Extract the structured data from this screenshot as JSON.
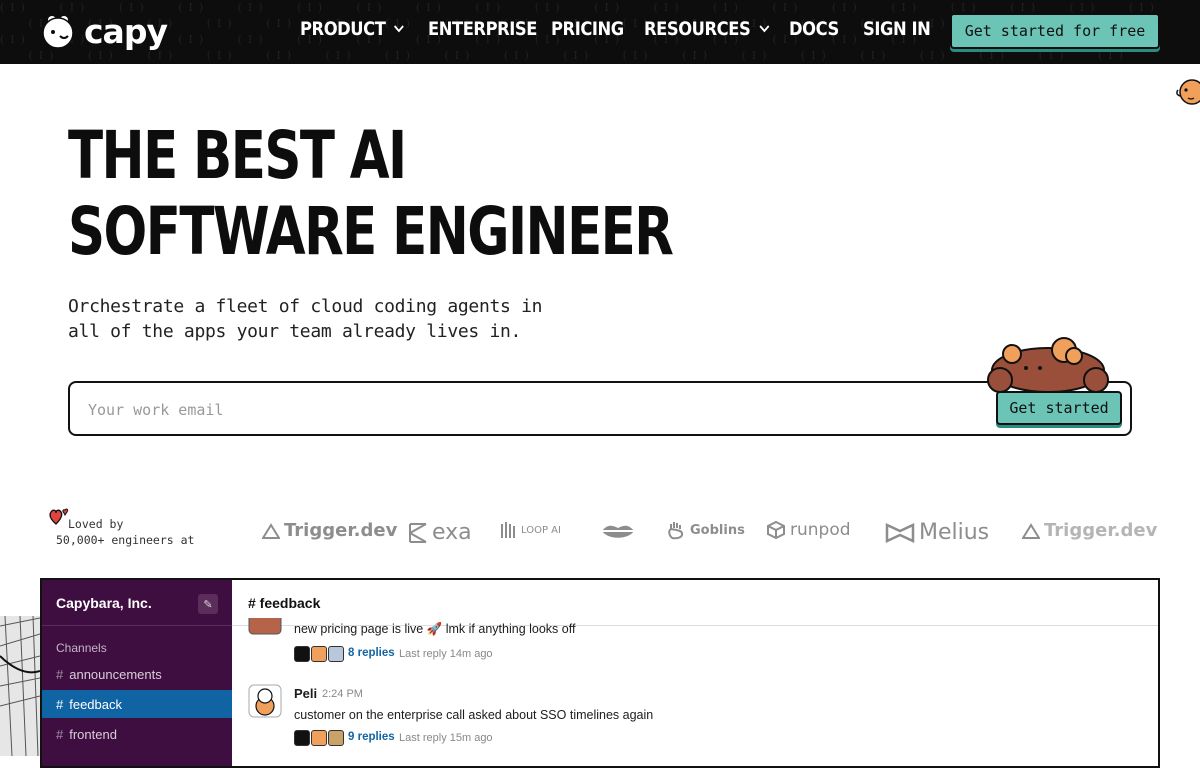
{
  "nav": {
    "logo_text": "capy",
    "links": [
      {
        "label": "PRODUCT",
        "dropdown": true
      },
      {
        "label": "ENTERPRISE",
        "dropdown": false
      },
      {
        "label": "PRICING",
        "dropdown": false
      },
      {
        "label": "RESOURCES",
        "dropdown": true
      },
      {
        "label": "DOCS",
        "dropdown": false
      },
      {
        "label": "SIGN IN",
        "dropdown": false
      }
    ],
    "cta_label": "Get started for free"
  },
  "hero": {
    "title_line1": "THE BEST AI",
    "title_line2": "SOFTWARE ENGINEER",
    "subtitle_line1": "Orchestrate a fleet of cloud coding agents in",
    "subtitle_line2": "all of the apps your team already lives in.",
    "email_placeholder": "Your work email",
    "cta_label": "Get started"
  },
  "social_proof": {
    "loved_line1": "Loved by",
    "loved_line2": "50,000+ engineers at",
    "brands": [
      {
        "name": "Trigger.dev",
        "icon": "triangle-icon"
      },
      {
        "name": "exa",
        "icon": "exa-icon"
      },
      {
        "name": "LOOP AI",
        "icon": "loop-icon"
      },
      {
        "name": "",
        "icon": "lips-icon"
      },
      {
        "name": "Goblins",
        "icon": "hand-icon"
      },
      {
        "name": "runpod",
        "icon": "cube-icon"
      },
      {
        "name": "Melius",
        "icon": "bowtie-icon"
      },
      {
        "name": "Trigger.dev",
        "icon": "triangle-icon"
      }
    ]
  },
  "slack": {
    "workspace": "Capybara, Inc.",
    "channels_heading": "Channels",
    "channels": [
      "announcements",
      "feedback",
      "frontend"
    ],
    "active_channel": "feedback",
    "channel_header": "# feedback",
    "messages": [
      {
        "author": "",
        "time": "",
        "text": "new pricing page is live 🚀 lmk if anything looks off",
        "replies": "8 replies",
        "last_reply": "Last reply 14m ago"
      },
      {
        "author": "Peli",
        "time": "2:24 PM",
        "text": "customer on the enterprise call asked about SSO timelines again",
        "replies": "9 replies",
        "last_reply": "Last reply 15m ago"
      }
    ]
  },
  "colors": {
    "nav_bg": "#0d0d0d",
    "accent_teal": "#6cc4b6",
    "slack_sidebar": "#3f0e40",
    "slack_active": "#1164a3",
    "link_blue": "#1264a3"
  }
}
